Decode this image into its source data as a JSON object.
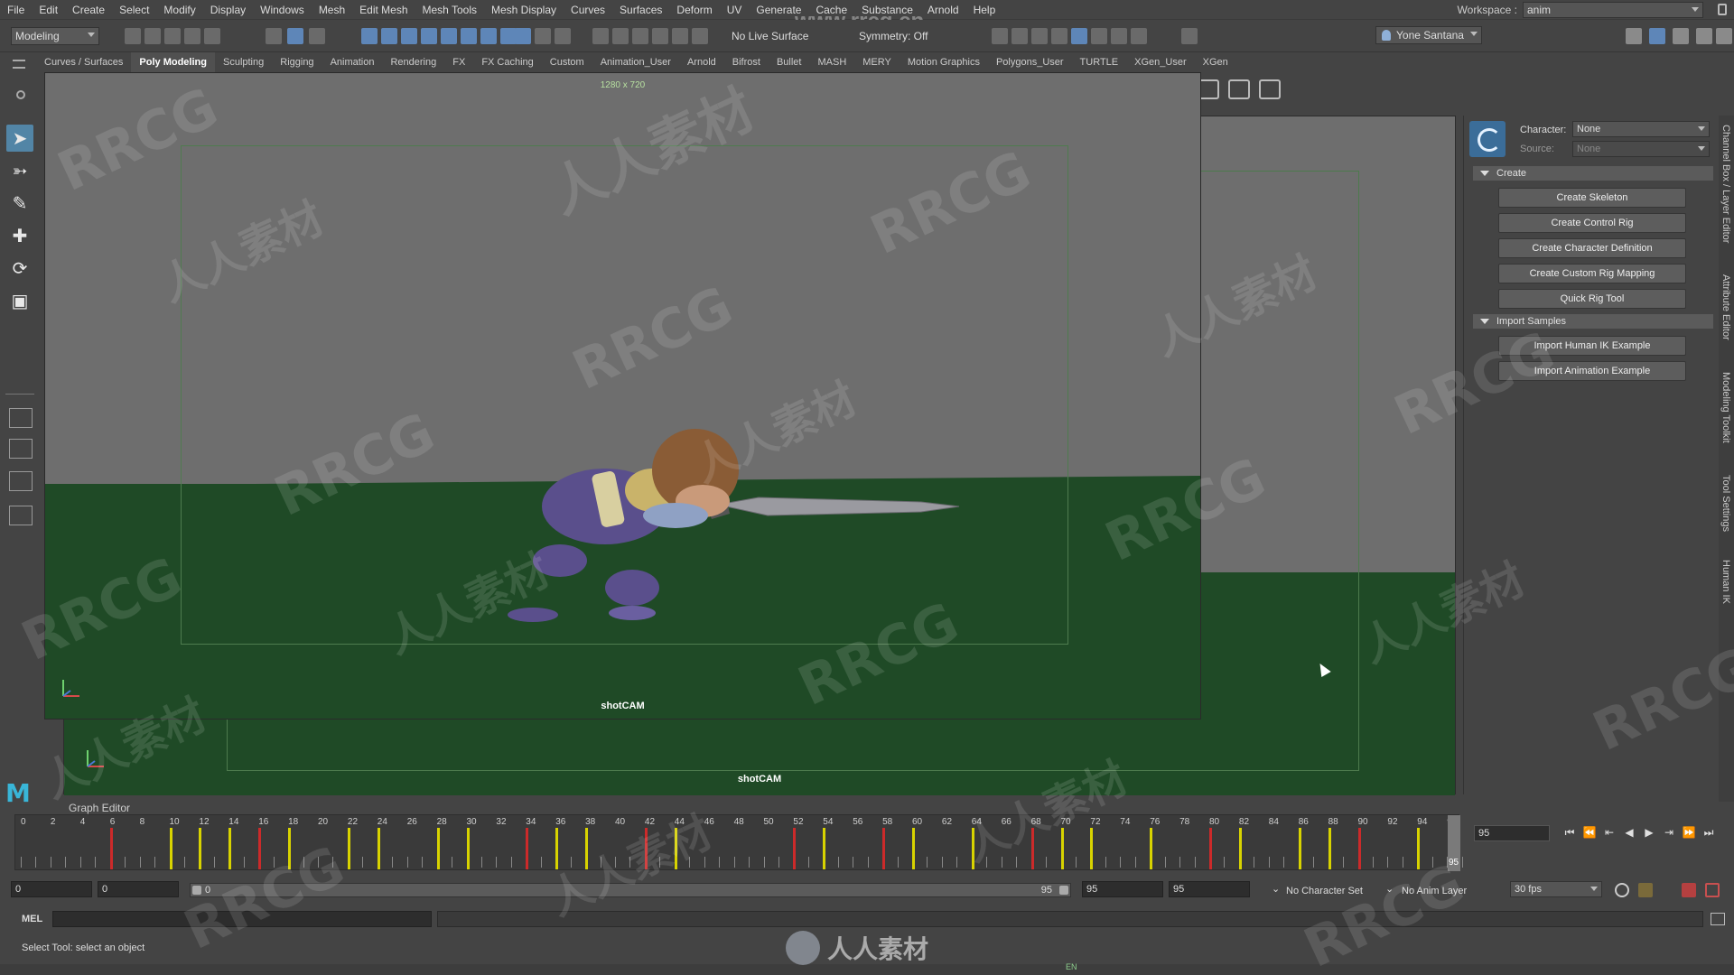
{
  "menu": [
    "File",
    "Edit",
    "Create",
    "Select",
    "Modify",
    "Display",
    "Windows",
    "Mesh",
    "Edit Mesh",
    "Mesh Tools",
    "Mesh Display",
    "Curves",
    "Surfaces",
    "Deform",
    "UV",
    "Generate",
    "Cache",
    "Substance",
    "Arnold",
    "Help"
  ],
  "workspace": {
    "label": "Workspace :",
    "value": "anim"
  },
  "statusline": {
    "mode": "Modeling",
    "live_surface": "No Live Surface",
    "symmetry": "Symmetry: Off",
    "user": "Yone Santana"
  },
  "shelf_tabs": [
    "Curves / Surfaces",
    "Poly Modeling",
    "Sculpting",
    "Rigging",
    "Animation",
    "Rendering",
    "FX",
    "FX Caching",
    "Custom",
    "Animation_User",
    "Arnold",
    "Bifrost",
    "Bullet",
    "MASH",
    "MERY",
    "Motion Graphics",
    "Polygons_User",
    "TURTLE",
    "XGen_User",
    "XGen"
  ],
  "active_shelf_tab": "Poly Modeling",
  "viewport": {
    "resolution": "1280 x 720",
    "camera": "shotCAM",
    "back_camera": "shotCAM"
  },
  "hik": {
    "character_label": "Character:",
    "character_value": "None",
    "source_label": "Source:",
    "source_value": "None",
    "create_header": "Create",
    "create_buttons": [
      "Create Skeleton",
      "Create Control Rig",
      "Create Character Definition",
      "Create Custom Rig Mapping",
      "Quick Rig Tool"
    ],
    "import_header": "Import Samples",
    "import_buttons": [
      "Import Human IK Example",
      "Import Animation Example"
    ]
  },
  "side_tabs": [
    "Channel Box / Layer Editor",
    "Attribute Editor",
    "Modeling Toolkit",
    "Tool Settings",
    "Human IK"
  ],
  "graph_editor_label": "Graph Editor",
  "timeline": {
    "labels": [
      "0",
      "2",
      "4",
      "6",
      "8",
      "10",
      "12",
      "14",
      "16",
      "18",
      "20",
      "22",
      "24",
      "26",
      "28",
      "30",
      "32",
      "34",
      "36",
      "38",
      "40",
      "42",
      "44",
      "46",
      "48",
      "50",
      "52",
      "54",
      "56",
      "58",
      "60",
      "62",
      "64",
      "66",
      "68",
      "70",
      "72",
      "74",
      "76",
      "78",
      "80",
      "82",
      "84",
      "86",
      "88",
      "90",
      "92",
      "94",
      "9"
    ],
    "current_frame": "95",
    "playhead_label": "95",
    "current_field": "95"
  },
  "range": {
    "start": "0",
    "anim_start": "0",
    "slider_start": "0",
    "slider_end": "95",
    "end": "95",
    "anim_end": "95",
    "character_set": "No Character Set",
    "anim_layer": "No Anim Layer",
    "fps": "30 fps"
  },
  "mel": {
    "label": "MEL"
  },
  "help_line": "Select Tool: select an object",
  "lang_indicator": "EN",
  "watermark": {
    "url": "www.rrcg.cn",
    "brand": "人人素材",
    "text_a": "RRCG",
    "text_b": "人人素材"
  },
  "colors": {
    "accent": "#5285a6",
    "ground": "#1f4a26",
    "key_yellow": "#d8d300",
    "key_red": "#cc2a2a"
  }
}
